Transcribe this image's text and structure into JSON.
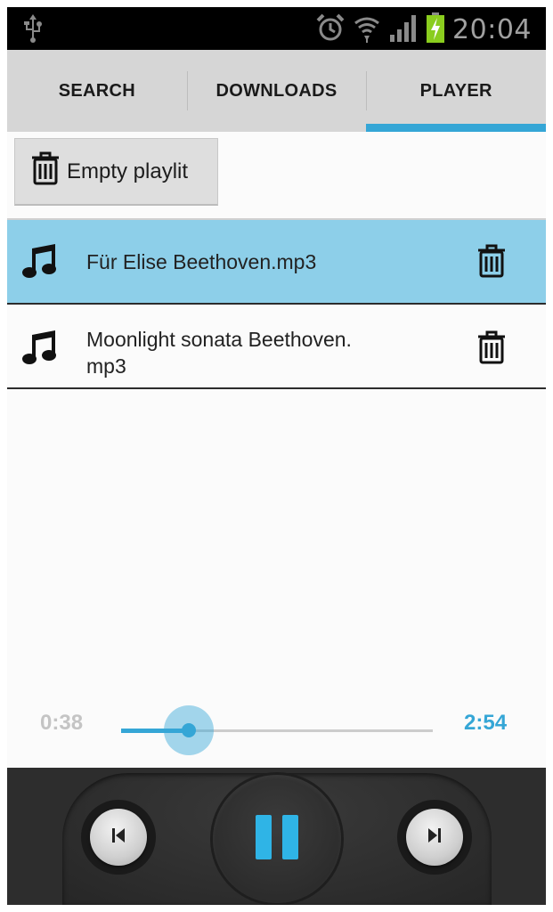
{
  "status_bar": {
    "time": "20:04",
    "icons": [
      "usb-icon",
      "alarm-icon",
      "wifi-icon",
      "signal-icon",
      "battery-charging-icon"
    ]
  },
  "tabs": [
    {
      "label": "SEARCH",
      "active": false
    },
    {
      "label": "DOWNLOADS",
      "active": false
    },
    {
      "label": "PLAYER",
      "active": true
    }
  ],
  "toolbar": {
    "empty_playlist_label": "Empty playlit"
  },
  "playlist": {
    "items": [
      {
        "title": "Für Elise Beethoven.mp3",
        "selected": true,
        "icon": "music-note-icon",
        "action_icon": "trash-icon"
      },
      {
        "title": "Moonlight sonata Beethoven.\nmp3",
        "selected": false,
        "icon": "music-note-icon",
        "action_icon": "trash-icon"
      }
    ]
  },
  "player": {
    "elapsed": "0:38",
    "total": "2:54",
    "progress_fraction": 0.218,
    "state": "playing",
    "controls": [
      "previous-icon",
      "pause-icon",
      "next-icon"
    ]
  },
  "colors": {
    "accent": "#35a6d6",
    "selected_row": "#8dcfe9",
    "tab_bar": "#d6d6d6",
    "controls_bg": "#2d2d2d"
  }
}
